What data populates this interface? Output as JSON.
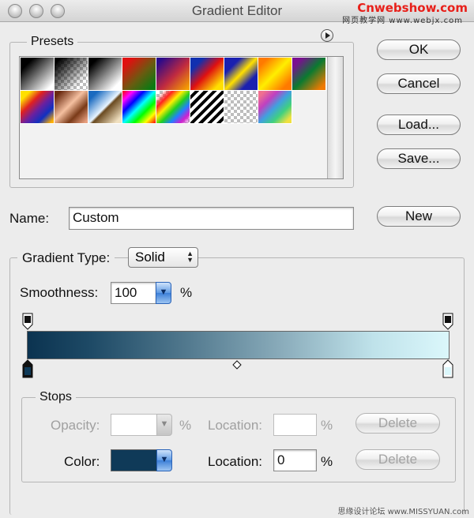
{
  "window": {
    "title": "Gradient Editor",
    "watermark_top": "Cnwebshow.com",
    "watermark_sub": "网页教学网 www.webjx.com",
    "watermark_bottom": "思缘设计论坛 www.MISSYUAN.com"
  },
  "presets": {
    "label": "Presets",
    "menu_icon": "play-circle-icon",
    "swatches": [
      {
        "name": "black-white"
      },
      {
        "name": "black-transparent"
      },
      {
        "name": "black-white-2"
      },
      {
        "name": "red-green"
      },
      {
        "name": "violet-orange"
      },
      {
        "name": "blue-red-yellow"
      },
      {
        "name": "blue-yellow-blue"
      },
      {
        "name": "orange-yellow-orange"
      },
      {
        "name": "violet-green-orange"
      },
      {
        "name": "yellow-violet-orange-blue"
      },
      {
        "name": "copper"
      },
      {
        "name": "chrome"
      },
      {
        "name": "spectrum"
      },
      {
        "name": "transparent-rainbow"
      },
      {
        "name": "transparent-stripes"
      },
      {
        "name": "foreground-transparent"
      },
      {
        "name": "pastel-rainbow"
      }
    ]
  },
  "buttons": {
    "ok": "OK",
    "cancel": "Cancel",
    "load": "Load...",
    "save": "Save...",
    "new": "New"
  },
  "name": {
    "label": "Name:",
    "value": "Custom"
  },
  "gradient": {
    "type_label": "Gradient Type:",
    "type_value": "Solid",
    "smoothness_label": "Smoothness:",
    "smoothness_value": "100",
    "smoothness_unit": "%",
    "start_color": "#0b3350",
    "end_color": "#dbf7fb"
  },
  "stops": {
    "label": "Stops",
    "opacity_label": "Opacity:",
    "opacity_value": "",
    "opacity_unit": "%",
    "opacity_location_label": "Location:",
    "opacity_location_value": "",
    "opacity_location_unit": "%",
    "opacity_delete": "Delete",
    "color_label": "Color:",
    "color_value": "#0f3a58",
    "color_location_label": "Location:",
    "color_location_value": "0",
    "color_location_unit": "%",
    "color_delete": "Delete"
  }
}
